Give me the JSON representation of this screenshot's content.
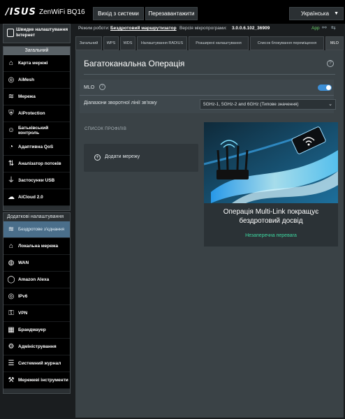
{
  "header": {
    "logo": "/ISUS",
    "model": "ZenWiFi BQ16",
    "logout_label": "Вихід з системи",
    "reboot_label": "Перезавантажити",
    "language": "Українська"
  },
  "status": {
    "mode_label": "Режим роботи:",
    "mode_value": "Бездротовий маршрутизатор",
    "firmware_label": "Версія мікропрограми:",
    "firmware_value": "3.0.0.6.102_36909",
    "app_label": "App"
  },
  "sidebar": {
    "qis_label": "Швидке налаштування Інтернет",
    "general_title": "Загальний",
    "general_items": [
      {
        "label": "Карта мережі",
        "icon": "network-map-icon"
      },
      {
        "label": "AiMesh",
        "icon": "aimesh-icon"
      },
      {
        "label": "Мережа",
        "icon": "wifi-network-icon"
      },
      {
        "label": "AiProtection",
        "icon": "shield-icon"
      },
      {
        "label": "Батьківський контроль",
        "icon": "parental-control-icon"
      },
      {
        "label": "Адаптивна QoS",
        "icon": "qos-gauge-icon"
      },
      {
        "label": "Аналізатор потоків",
        "icon": "traffic-analyzer-icon"
      },
      {
        "label": "Застосунки USB",
        "icon": "usb-icon"
      },
      {
        "label": "AiCloud 2.0",
        "icon": "cloud-icon"
      }
    ],
    "advanced_title": "Додаткові налаштування",
    "advanced_items": [
      {
        "label": "Бездротове з'єднання",
        "icon": "wireless-icon",
        "active": true
      },
      {
        "label": "Локальна мережа",
        "icon": "lan-icon"
      },
      {
        "label": "WAN",
        "icon": "wan-globe-icon"
      },
      {
        "label": "Amazon Alexa",
        "icon": "alexa-icon"
      },
      {
        "label": "IPv6",
        "icon": "ipv6-icon"
      },
      {
        "label": "VPN",
        "icon": "vpn-icon"
      },
      {
        "label": "Брандмауер",
        "icon": "firewall-icon"
      },
      {
        "label": "Адміністрування",
        "icon": "admin-icon"
      },
      {
        "label": "Системний журнал",
        "icon": "log-icon"
      },
      {
        "label": "Мережеві інструменти",
        "icon": "tools-icon"
      }
    ]
  },
  "tabs": [
    {
      "label": "Загальний"
    },
    {
      "label": "WPS"
    },
    {
      "label": "WDS"
    },
    {
      "label": "Налаштування RADIUS"
    },
    {
      "label": "Розширені налаштування"
    },
    {
      "label": "Список блокування переміщення"
    },
    {
      "label": "MLO",
      "active": true
    }
  ],
  "main": {
    "title": "Багатоканальна Операція",
    "mlo_label": "MLO",
    "mlo_enabled": true,
    "backhaul_label": "Діапазони зворотної лінії зв'язку",
    "backhaul_value": "5GHz-1, 5GHz-2 and 6GHz (Типове значення)",
    "profiles_label": "СПИСОК ПРОФІЛІВ",
    "add_network_label": "Додати мережу",
    "promo_title": "Операція Multi-Link покращує бездротовий досвід",
    "promo_subtitle": "Незаперечна перевага"
  },
  "colors": {
    "accent": "#3d8fd6",
    "active_menu": "#4a6e8a",
    "promo_link": "#3ed7a0",
    "app_badge": "#6ad06a"
  }
}
